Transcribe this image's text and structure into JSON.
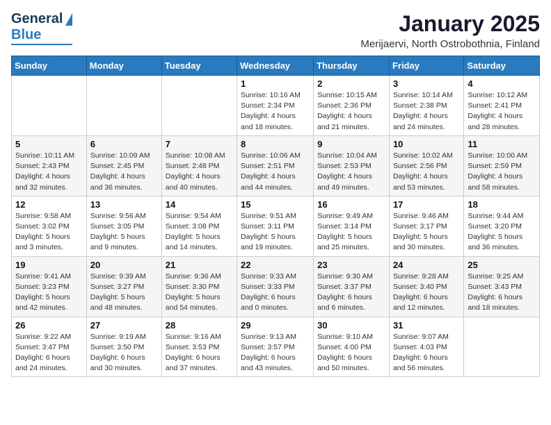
{
  "header": {
    "logo_general": "General",
    "logo_blue": "Blue",
    "title": "January 2025",
    "subtitle": "Merijaervi, North Ostrobothnia, Finland"
  },
  "weekdays": [
    "Sunday",
    "Monday",
    "Tuesday",
    "Wednesday",
    "Thursday",
    "Friday",
    "Saturday"
  ],
  "weeks": [
    [
      {
        "day": "",
        "sunrise": "",
        "sunset": "",
        "daylight": ""
      },
      {
        "day": "",
        "sunrise": "",
        "sunset": "",
        "daylight": ""
      },
      {
        "day": "",
        "sunrise": "",
        "sunset": "",
        "daylight": ""
      },
      {
        "day": "1",
        "sunrise": "Sunrise: 10:16 AM",
        "sunset": "Sunset: 2:34 PM",
        "daylight": "Daylight: 4 hours and 18 minutes."
      },
      {
        "day": "2",
        "sunrise": "Sunrise: 10:15 AM",
        "sunset": "Sunset: 2:36 PM",
        "daylight": "Daylight: 4 hours and 21 minutes."
      },
      {
        "day": "3",
        "sunrise": "Sunrise: 10:14 AM",
        "sunset": "Sunset: 2:38 PM",
        "daylight": "Daylight: 4 hours and 24 minutes."
      },
      {
        "day": "4",
        "sunrise": "Sunrise: 10:12 AM",
        "sunset": "Sunset: 2:41 PM",
        "daylight": "Daylight: 4 hours and 28 minutes."
      }
    ],
    [
      {
        "day": "5",
        "sunrise": "Sunrise: 10:11 AM",
        "sunset": "Sunset: 2:43 PM",
        "daylight": "Daylight: 4 hours and 32 minutes."
      },
      {
        "day": "6",
        "sunrise": "Sunrise: 10:09 AM",
        "sunset": "Sunset: 2:45 PM",
        "daylight": "Daylight: 4 hours and 36 minutes."
      },
      {
        "day": "7",
        "sunrise": "Sunrise: 10:08 AM",
        "sunset": "Sunset: 2:48 PM",
        "daylight": "Daylight: 4 hours and 40 minutes."
      },
      {
        "day": "8",
        "sunrise": "Sunrise: 10:06 AM",
        "sunset": "Sunset: 2:51 PM",
        "daylight": "Daylight: 4 hours and 44 minutes."
      },
      {
        "day": "9",
        "sunrise": "Sunrise: 10:04 AM",
        "sunset": "Sunset: 2:53 PM",
        "daylight": "Daylight: 4 hours and 49 minutes."
      },
      {
        "day": "10",
        "sunrise": "Sunrise: 10:02 AM",
        "sunset": "Sunset: 2:56 PM",
        "daylight": "Daylight: 4 hours and 53 minutes."
      },
      {
        "day": "11",
        "sunrise": "Sunrise: 10:00 AM",
        "sunset": "Sunset: 2:59 PM",
        "daylight": "Daylight: 4 hours and 58 minutes."
      }
    ],
    [
      {
        "day": "12",
        "sunrise": "Sunrise: 9:58 AM",
        "sunset": "Sunset: 3:02 PM",
        "daylight": "Daylight: 5 hours and 3 minutes."
      },
      {
        "day": "13",
        "sunrise": "Sunrise: 9:56 AM",
        "sunset": "Sunset: 3:05 PM",
        "daylight": "Daylight: 5 hours and 9 minutes."
      },
      {
        "day": "14",
        "sunrise": "Sunrise: 9:54 AM",
        "sunset": "Sunset: 3:08 PM",
        "daylight": "Daylight: 5 hours and 14 minutes."
      },
      {
        "day": "15",
        "sunrise": "Sunrise: 9:51 AM",
        "sunset": "Sunset: 3:11 PM",
        "daylight": "Daylight: 5 hours and 19 minutes."
      },
      {
        "day": "16",
        "sunrise": "Sunrise: 9:49 AM",
        "sunset": "Sunset: 3:14 PM",
        "daylight": "Daylight: 5 hours and 25 minutes."
      },
      {
        "day": "17",
        "sunrise": "Sunrise: 9:46 AM",
        "sunset": "Sunset: 3:17 PM",
        "daylight": "Daylight: 5 hours and 30 minutes."
      },
      {
        "day": "18",
        "sunrise": "Sunrise: 9:44 AM",
        "sunset": "Sunset: 3:20 PM",
        "daylight": "Daylight: 5 hours and 36 minutes."
      }
    ],
    [
      {
        "day": "19",
        "sunrise": "Sunrise: 9:41 AM",
        "sunset": "Sunset: 3:23 PM",
        "daylight": "Daylight: 5 hours and 42 minutes."
      },
      {
        "day": "20",
        "sunrise": "Sunrise: 9:39 AM",
        "sunset": "Sunset: 3:27 PM",
        "daylight": "Daylight: 5 hours and 48 minutes."
      },
      {
        "day": "21",
        "sunrise": "Sunrise: 9:36 AM",
        "sunset": "Sunset: 3:30 PM",
        "daylight": "Daylight: 5 hours and 54 minutes."
      },
      {
        "day": "22",
        "sunrise": "Sunrise: 9:33 AM",
        "sunset": "Sunset: 3:33 PM",
        "daylight": "Daylight: 6 hours and 0 minutes."
      },
      {
        "day": "23",
        "sunrise": "Sunrise: 9:30 AM",
        "sunset": "Sunset: 3:37 PM",
        "daylight": "Daylight: 6 hours and 6 minutes."
      },
      {
        "day": "24",
        "sunrise": "Sunrise: 9:28 AM",
        "sunset": "Sunset: 3:40 PM",
        "daylight": "Daylight: 6 hours and 12 minutes."
      },
      {
        "day": "25",
        "sunrise": "Sunrise: 9:25 AM",
        "sunset": "Sunset: 3:43 PM",
        "daylight": "Daylight: 6 hours and 18 minutes."
      }
    ],
    [
      {
        "day": "26",
        "sunrise": "Sunrise: 9:22 AM",
        "sunset": "Sunset: 3:47 PM",
        "daylight": "Daylight: 6 hours and 24 minutes."
      },
      {
        "day": "27",
        "sunrise": "Sunrise: 9:19 AM",
        "sunset": "Sunset: 3:50 PM",
        "daylight": "Daylight: 6 hours and 30 minutes."
      },
      {
        "day": "28",
        "sunrise": "Sunrise: 9:16 AM",
        "sunset": "Sunset: 3:53 PM",
        "daylight": "Daylight: 6 hours and 37 minutes."
      },
      {
        "day": "29",
        "sunrise": "Sunrise: 9:13 AM",
        "sunset": "Sunset: 3:57 PM",
        "daylight": "Daylight: 6 hours and 43 minutes."
      },
      {
        "day": "30",
        "sunrise": "Sunrise: 9:10 AM",
        "sunset": "Sunset: 4:00 PM",
        "daylight": "Daylight: 6 hours and 50 minutes."
      },
      {
        "day": "31",
        "sunrise": "Sunrise: 9:07 AM",
        "sunset": "Sunset: 4:03 PM",
        "daylight": "Daylight: 6 hours and 56 minutes."
      },
      {
        "day": "",
        "sunrise": "",
        "sunset": "",
        "daylight": ""
      }
    ]
  ]
}
